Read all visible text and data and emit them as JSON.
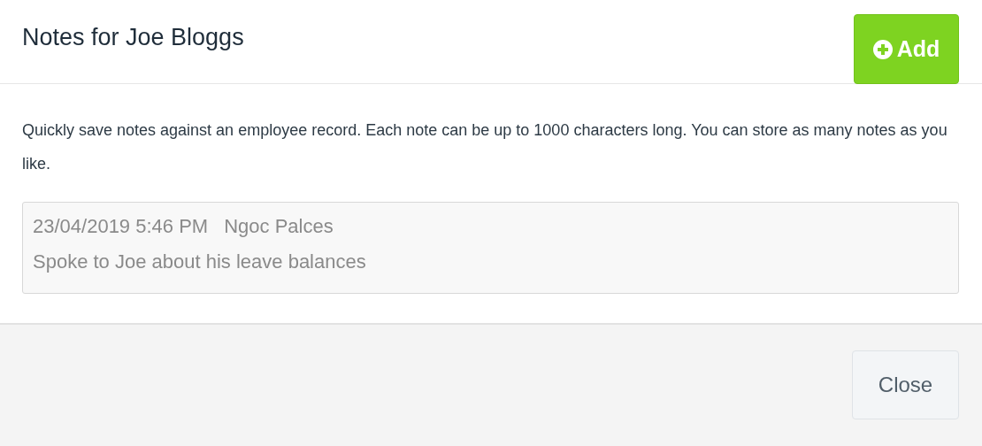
{
  "dialog": {
    "title": "Notes for Joe Bloggs",
    "add_button": "Add",
    "description": "Quickly save notes against an employee record. Each note can be up to 1000 characters long. You can store as many notes as you like.",
    "notes": [
      {
        "timestamp": "23/04/2019 5:46 PM",
        "author": "Ngoc Palces",
        "text": "Spoke to Joe about his leave balances"
      }
    ],
    "close_button": "Close"
  }
}
